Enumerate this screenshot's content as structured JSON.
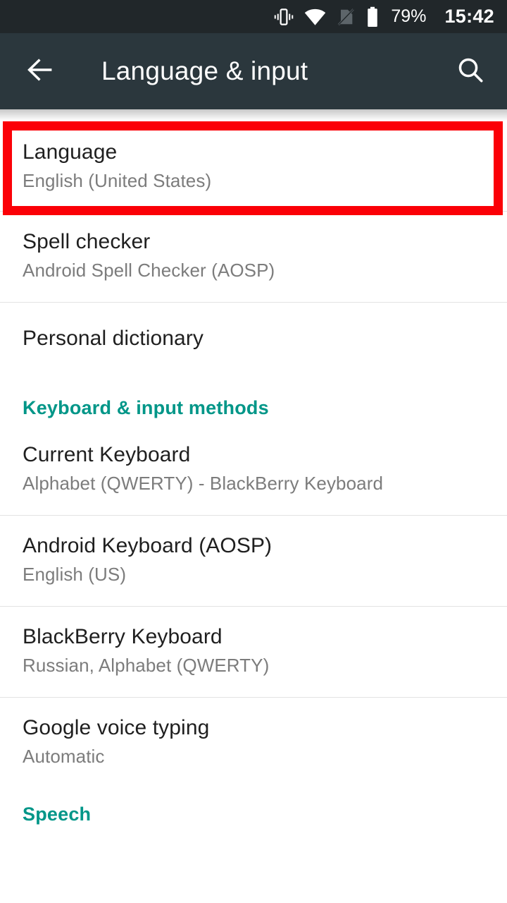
{
  "status_bar": {
    "icons": [
      "vibrate-icon",
      "wifi-icon",
      "no-sim-icon",
      "battery-icon"
    ],
    "battery_percent": "79%",
    "clock": "15:42"
  },
  "app_bar": {
    "back_label": "back-arrow",
    "title": "Language & input",
    "search_label": "search"
  },
  "highlight": {
    "color": "#fb0007",
    "target": "Language"
  },
  "theme": {
    "accent": "#009688",
    "status_bar_bg": "#21272a",
    "app_bar_bg": "#2b373d",
    "title_color": "#1f1f1f",
    "subtitle_color": "#7c7c7c",
    "divider_color": "#e3e3e3"
  },
  "list": [
    {
      "type": "item",
      "name": "language",
      "title": "Language",
      "subtitle": "English (United States)",
      "highlighted": true
    },
    {
      "type": "item",
      "name": "spell-checker",
      "title": "Spell checker",
      "subtitle": "Android Spell Checker (AOSP)"
    },
    {
      "type": "item",
      "name": "personal-dictionary",
      "title": "Personal dictionary",
      "subtitle": ""
    },
    {
      "type": "section",
      "name": "keyboard-and-input-methods",
      "title": "Keyboard & input methods"
    },
    {
      "type": "item",
      "name": "current-keyboard",
      "title": "Current Keyboard",
      "subtitle": "Alphabet (QWERTY) - BlackBerry Keyboard"
    },
    {
      "type": "item",
      "name": "android-keyboard-aosp",
      "title": "Android Keyboard (AOSP)",
      "subtitle": "English (US)"
    },
    {
      "type": "item",
      "name": "blackberry-keyboard",
      "title": "BlackBerry Keyboard",
      "subtitle": "Russian, Alphabet (QWERTY)"
    },
    {
      "type": "item",
      "name": "google-voice-typing",
      "title": "Google voice typing",
      "subtitle": "Automatic"
    },
    {
      "type": "section",
      "name": "speech",
      "title": "Speech"
    }
  ]
}
